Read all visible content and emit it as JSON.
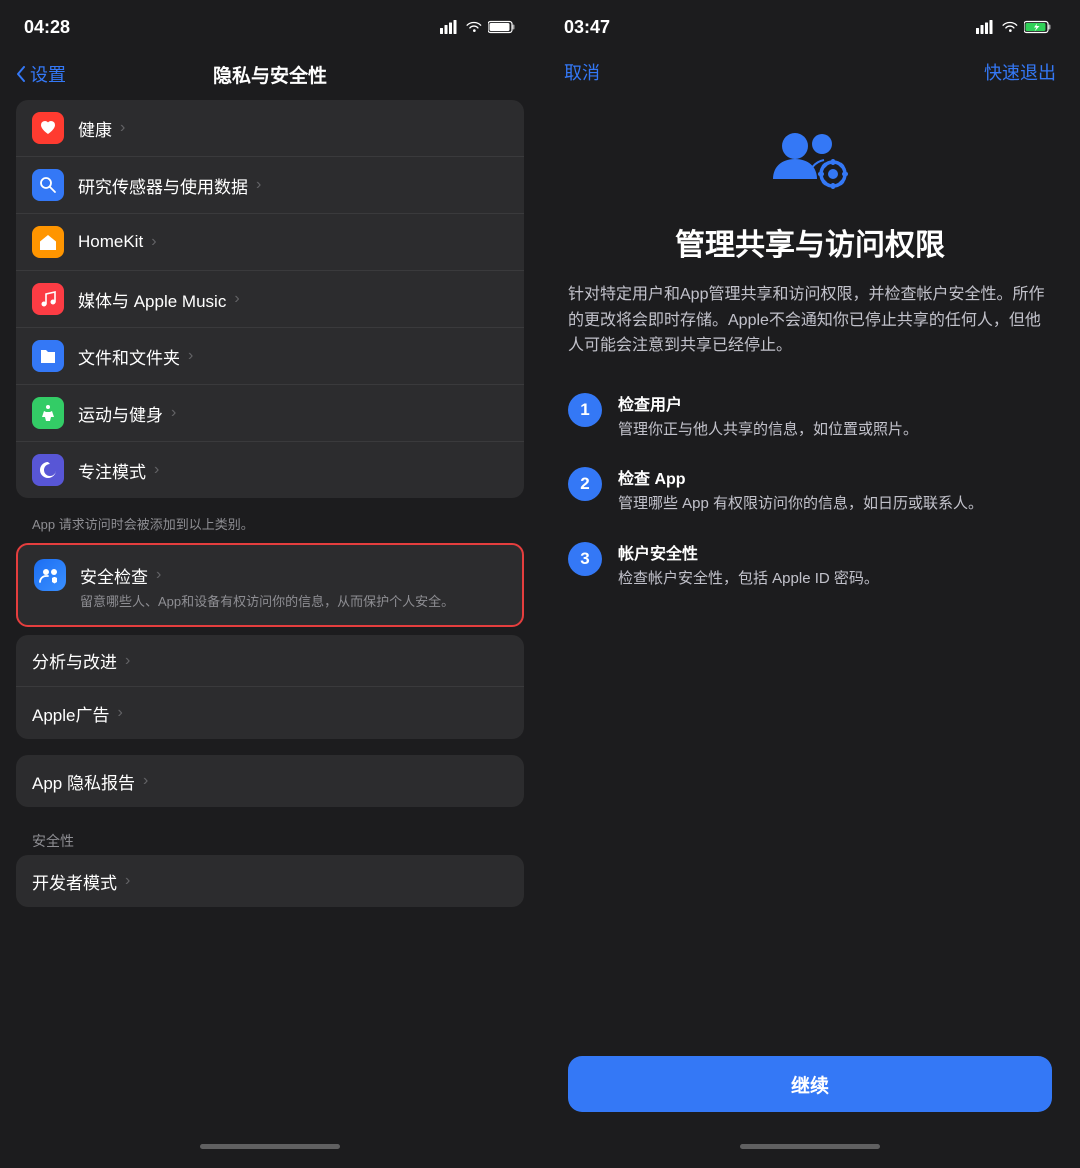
{
  "left": {
    "status": {
      "time": "04:28"
    },
    "nav": {
      "back_label": "设置",
      "title": "隐私与安全性"
    },
    "list_items": [
      {
        "id": "health",
        "icon_class": "icon-health",
        "icon_char": "❤️",
        "label": "健康",
        "has_chevron": true
      },
      {
        "id": "research",
        "icon_class": "icon-research",
        "icon_char": "🔬",
        "label": "研究传感器与使用数据",
        "has_chevron": true
      },
      {
        "id": "homekit",
        "icon_class": "icon-homekit",
        "icon_char": "🏠",
        "label": "HomeKit",
        "has_chevron": true
      },
      {
        "id": "music",
        "icon_class": "icon-music",
        "icon_char": "🎵",
        "label": "媒体与 Apple Music",
        "has_chevron": true
      },
      {
        "id": "files",
        "icon_class": "icon-files",
        "icon_char": "📁",
        "label": "文件和文件夹",
        "has_chevron": true
      },
      {
        "id": "fitness",
        "icon_class": "icon-fitness",
        "icon_char": "🏃",
        "label": "运动与健身",
        "has_chevron": true
      },
      {
        "id": "focus",
        "icon_class": "icon-focus",
        "icon_char": "🌙",
        "label": "专注模式",
        "has_chevron": true
      }
    ],
    "section_note": "App 请求访问时会被添加到以上类别。",
    "safety_check": {
      "label": "安全检查",
      "sublabel": "留意哪些人、App和设备有权访问你的信息，从而保护个人安全。",
      "has_chevron": true
    },
    "bottom_items_group1": [
      {
        "id": "analytics",
        "label": "分析与改进",
        "has_chevron": true
      },
      {
        "id": "apple_ads",
        "label": "Apple广告",
        "has_chevron": true
      }
    ],
    "bottom_items_group2": [
      {
        "id": "app_privacy",
        "label": "App 隐私报告",
        "has_chevron": true
      }
    ],
    "security_label": "安全性",
    "bottom_items_group3": [
      {
        "id": "dev_mode",
        "label": "开发者模式",
        "has_chevron": true
      }
    ]
  },
  "right": {
    "status": {
      "time": "03:47"
    },
    "nav": {
      "cancel": "取消",
      "quick_exit": "快速退出"
    },
    "title": "管理共享与访问权限",
    "description": "针对特定用户和App管理共享和访问权限，并检查帐户安全性。所作的更改将会即时存储。Apple不会通知你已停止共享的任何人，但他人可能会注意到共享已经停止。",
    "steps": [
      {
        "number": "1",
        "title": "检查用户",
        "desc": "管理你正与他人共享的信息，如位置或照片。"
      },
      {
        "number": "2",
        "title": "检查 App",
        "desc": "管理哪些 App 有权限访问你的信息，如日历或联系人。"
      },
      {
        "number": "3",
        "title": "帐户安全性",
        "desc": "检查帐户安全性，包括 Apple ID 密码。"
      }
    ],
    "continue_btn": "继续"
  }
}
